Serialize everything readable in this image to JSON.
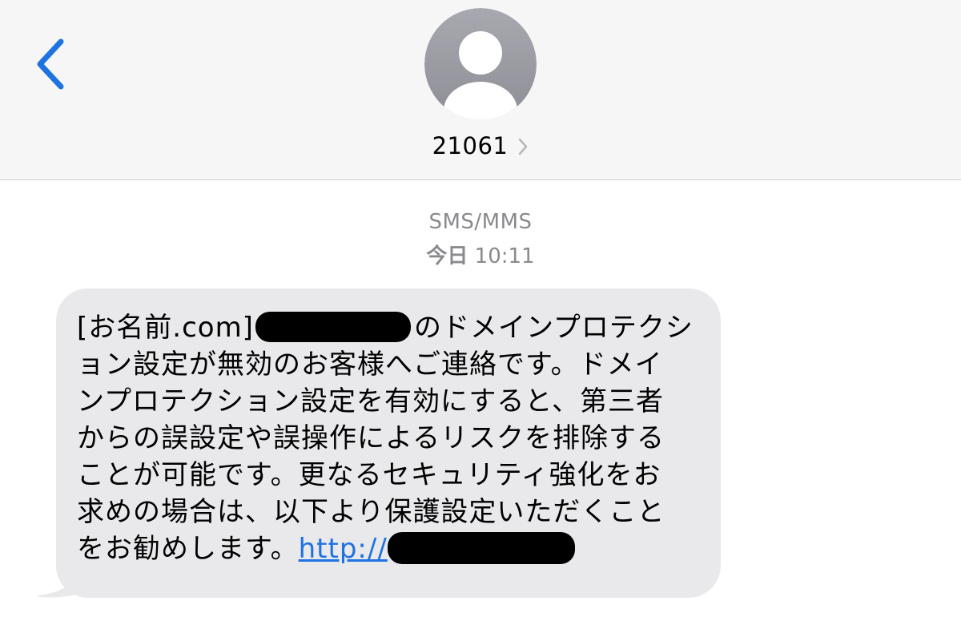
{
  "header": {
    "back_icon": "chevron-left-icon",
    "avatar_icon": "person-silhouette-icon",
    "contact_name": "21061",
    "contact_chevron": "chevron-right-icon"
  },
  "thread": {
    "service": "SMS/MMS",
    "timestamp_day": "今日",
    "timestamp_time": "10:11"
  },
  "message": {
    "line1_prefix": "[お名前.com]",
    "line1_suffix": "のドメインプロテクシ",
    "line2": "ョン設定が無効のお客様へご連絡です。ドメイ",
    "line3": "ンプロテクション設定を有効にすると、第三者",
    "line4": "からの誤設定や誤操作によるリスクを排除する",
    "line5": "ことが可能です。更なるセキュリティ強化をお",
    "line6": "求めの場合は、以下より保護設定いただくこと",
    "line7_prefix": "をお勧めします。",
    "link_text": "http://"
  },
  "colors": {
    "header_bg": "#f6f6f6",
    "accent_blue": "#1e73e0",
    "bubble_bg": "#e9e9eb",
    "meta_gray": "#8a8a8e",
    "avatar_gray": "#9a9ba2"
  }
}
